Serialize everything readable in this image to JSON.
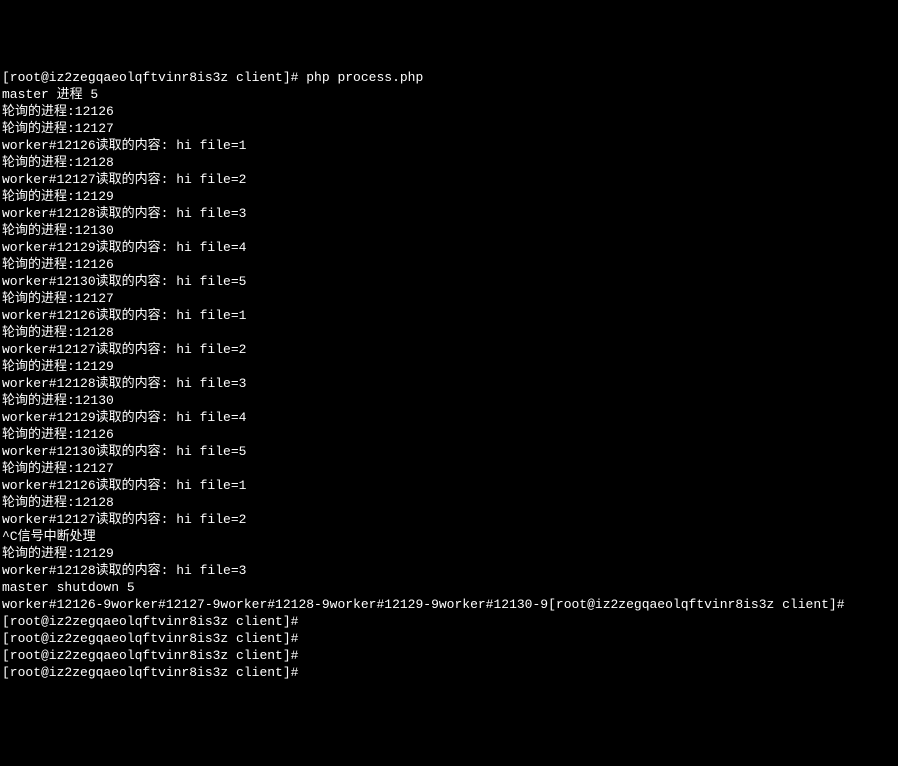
{
  "terminal": {
    "lines": [
      "[root@iz2zegqaeolqftvinr8is3z client]# php process.php",
      "master 进程 5",
      "轮询的进程:12126",
      "轮询的进程:12127",
      "worker#12126读取的内容: hi file=1",
      "轮询的进程:12128",
      "worker#12127读取的内容: hi file=2",
      "轮询的进程:12129",
      "worker#12128读取的内容: hi file=3",
      "轮询的进程:12130",
      "worker#12129读取的内容: hi file=4",
      "轮询的进程:12126",
      "worker#12130读取的内容: hi file=5",
      "轮询的进程:12127",
      "worker#12126读取的内容: hi file=1",
      "轮询的进程:12128",
      "worker#12127读取的内容: hi file=2",
      "轮询的进程:12129",
      "worker#12128读取的内容: hi file=3",
      "轮询的进程:12130",
      "worker#12129读取的内容: hi file=4",
      "轮询的进程:12126",
      "worker#12130读取的内容: hi file=5",
      "轮询的进程:12127",
      "worker#12126读取的内容: hi file=1",
      "轮询的进程:12128",
      "worker#12127读取的内容: hi file=2",
      "^C信号中断处理",
      "轮询的进程:12129",
      "worker#12128读取的内容: hi file=3",
      "master shutdown 5",
      "worker#12126-9worker#12127-9worker#12128-9worker#12129-9worker#12130-9[root@iz2zegqaeolqftvinr8is3z client]#",
      "[root@iz2zegqaeolqftvinr8is3z client]#",
      "[root@iz2zegqaeolqftvinr8is3z client]#",
      "[root@iz2zegqaeolqftvinr8is3z client]#",
      "[root@iz2zegqaeolqftvinr8is3z client]#"
    ]
  }
}
